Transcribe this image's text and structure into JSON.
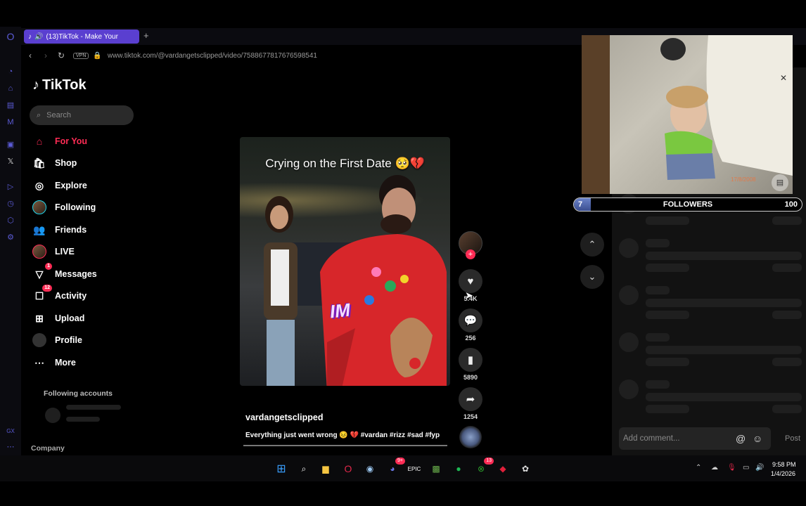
{
  "browser": {
    "tab_title": "(13)TikTok - Make Your",
    "new_tab": "+",
    "vpn": "VPN",
    "url": "www.tiktok.com/@vardangetsclipped/video/7588677817676598541"
  },
  "tiktok": {
    "logo": "TikTok",
    "search_placeholder": "Search",
    "nav": [
      {
        "label": "For You",
        "icon": "home-icon"
      },
      {
        "label": "Shop",
        "icon": "shop-icon"
      },
      {
        "label": "Explore",
        "icon": "compass-icon"
      },
      {
        "label": "Following",
        "icon": "avatar-icon"
      },
      {
        "label": "Friends",
        "icon": "friends-icon"
      },
      {
        "label": "LIVE",
        "icon": "avatar-icon"
      },
      {
        "label": "Messages",
        "icon": "send-icon",
        "badge": "1"
      },
      {
        "label": "Activity",
        "icon": "inbox-icon",
        "badge": "12"
      },
      {
        "label": "Upload",
        "icon": "plus-square-icon"
      },
      {
        "label": "Profile",
        "icon": "avatar-icon"
      },
      {
        "label": "More",
        "icon": "more-icon"
      }
    ],
    "following_accounts": "Following accounts",
    "company": "Company"
  },
  "video": {
    "caption": "Crying on the First Date 🥺💔",
    "sticker": "IM",
    "username": "vardangetsclipped",
    "description": "Everything just went wrong 😣 💔 #vardan #rizz #sad #fyp",
    "likes": "5.4K",
    "comments": "256",
    "saves": "5890",
    "shares": "1254"
  },
  "comments": {
    "placeholder": "Add comment...",
    "post": "Post"
  },
  "pip": {
    "date_stamp": "17/8/2008"
  },
  "followers_widget": {
    "label": "FOLLOWERS",
    "current": "7",
    "goal": "100",
    "progress": 0.07
  },
  "taskbar": {
    "time": "9:58 PM",
    "date": "1/4/2026",
    "discord_badge": "9+",
    "xbox_badge": "13"
  },
  "colors": {
    "accent": "#fe2c55",
    "opera_tab": "#5a3fd0",
    "progress": "#4a62b0"
  }
}
